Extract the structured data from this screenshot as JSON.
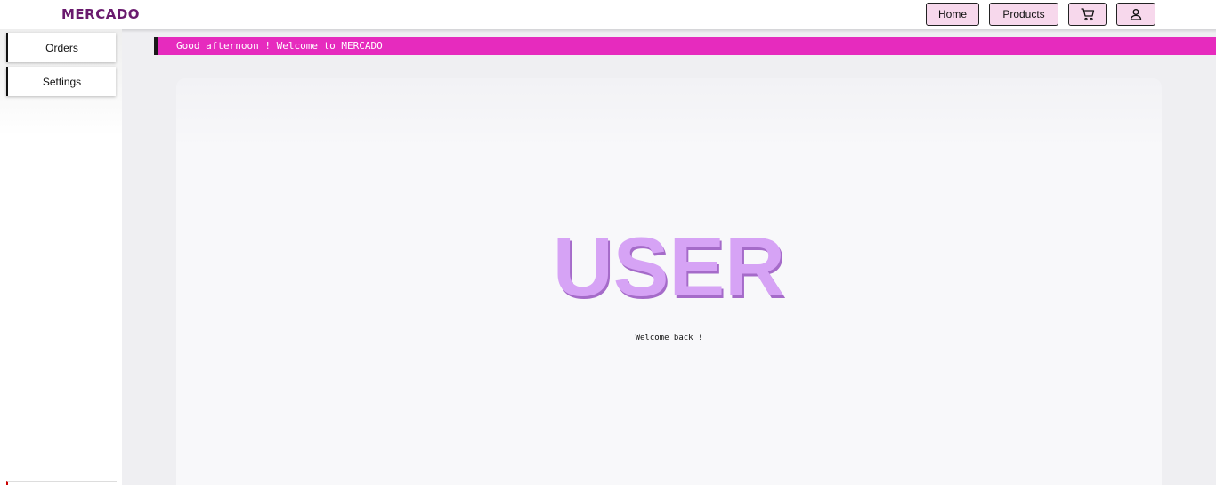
{
  "header": {
    "brand": "MERCADO",
    "nav": {
      "home_label": "Home",
      "products_label": "Products",
      "cart_icon": "cart-icon",
      "user_icon": "user-icon"
    },
    "button_color": "#f7d8ec",
    "brand_color": "#6a1a6e"
  },
  "sidebar": {
    "items": [
      {
        "label": "Orders"
      },
      {
        "label": "Settings"
      }
    ]
  },
  "main": {
    "banner_text": "Good afternoon ! Welcome to MERCADO",
    "banner_color": "#e62bbe",
    "title": "USER",
    "title_color": "#d6a3f5",
    "subtitle": "Welcome back !"
  }
}
